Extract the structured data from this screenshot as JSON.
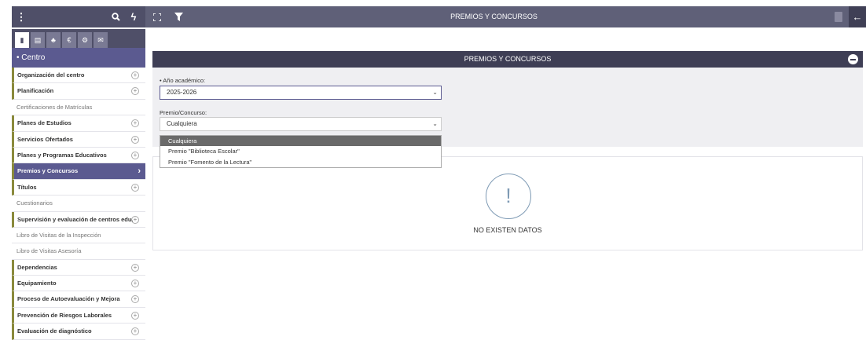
{
  "app": {
    "title": "PREMIOS Y CONCURSOS"
  },
  "topbar": {
    "icons": [
      "menu-icon",
      "search-icon",
      "lightning-icon",
      "expand-icon",
      "filter-icon"
    ],
    "glyphs": {
      "menu": "⋮",
      "search": "🔍︎",
      "bolt": "ϟ",
      "expand": "⛶",
      "filter": "▼",
      "back": "←"
    }
  },
  "tabs": {
    "glyphs": [
      "▮",
      "▤",
      "♣",
      "€",
      "⚙",
      "✉"
    ]
  },
  "sidebar": {
    "header": "• Centro",
    "items": [
      {
        "label": "Organización del centro",
        "expandable": true,
        "marked": true
      },
      {
        "label": "Planificación",
        "expandable": true,
        "marked": true
      },
      {
        "label": "Certificaciones de Matrículas",
        "expandable": false,
        "marked": false
      },
      {
        "label": "Planes de Estudios",
        "expandable": true,
        "marked": true
      },
      {
        "label": "Servicios Ofertados",
        "expandable": true,
        "marked": true
      },
      {
        "label": "Planes y Programas Educativos",
        "expandable": true,
        "marked": true
      },
      {
        "label": "Premios y Concursos",
        "expandable": false,
        "marked": true,
        "active": true
      },
      {
        "label": "Títulos",
        "expandable": true,
        "marked": true
      },
      {
        "label": "Cuestionarios",
        "expandable": false,
        "marked": false
      },
      {
        "label": "Supervisión y evaluación de centros edu.",
        "expandable": true,
        "marked": true
      },
      {
        "label": "Libro de Visitas de la Inspección",
        "expandable": false,
        "marked": false
      },
      {
        "label": "Libro de Visitas Asesoría",
        "expandable": false,
        "marked": false
      },
      {
        "label": "Dependencias",
        "expandable": true,
        "marked": true
      },
      {
        "label": "Equipamiento",
        "expandable": true,
        "marked": true
      },
      {
        "label": "Proceso de Autoevaluación y Mejora",
        "expandable": true,
        "marked": true
      },
      {
        "label": "Prevención de Riesgos Laborales",
        "expandable": true,
        "marked": true
      },
      {
        "label": "Evaluación de diagnóstico",
        "expandable": true,
        "marked": true
      }
    ]
  },
  "panel": {
    "title": "PREMIOS Y CONCURSOS",
    "year_label": "• Año académico:",
    "year_value": "2025-2026",
    "award_label": "Premio/Concurso:",
    "award_value": "Cualquiera",
    "award_options": [
      "Cualquiera",
      "Premio \"Biblioteca Escolar\"",
      "Premio \"Fomento de la Lectura\""
    ]
  },
  "results": {
    "empty_text": "NO EXISTEN DATOS",
    "empty_glyph": "!"
  },
  "colors": {
    "topbar": "#5f6078",
    "sidebar_active": "#5b5a90",
    "panel_header": "#3e3e55",
    "marker": "#8a8a3c"
  }
}
